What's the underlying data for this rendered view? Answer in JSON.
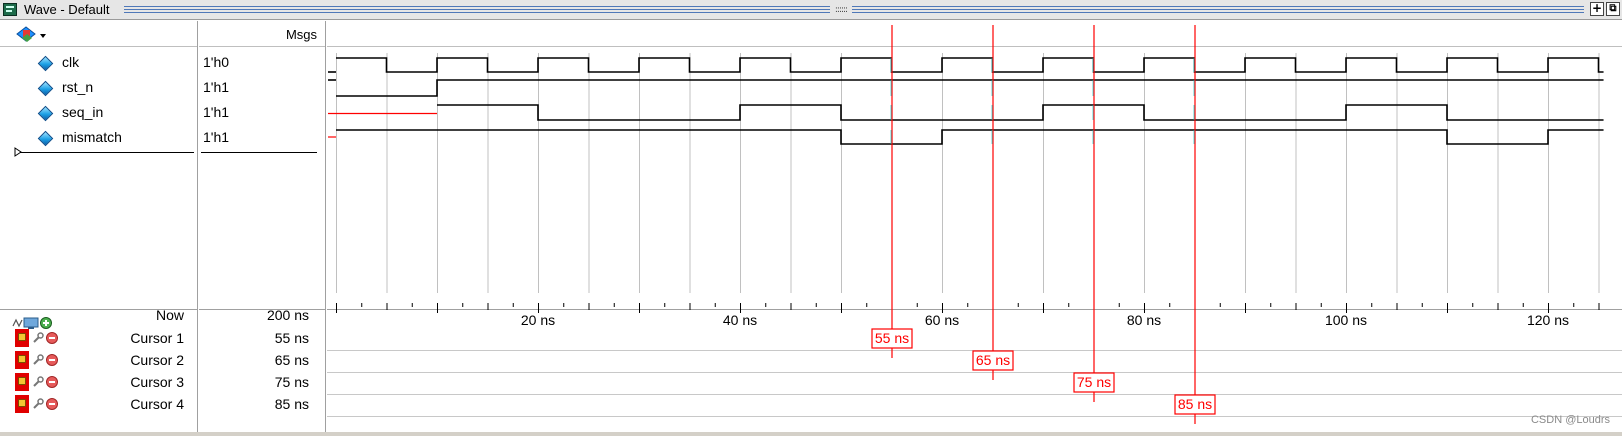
{
  "window": {
    "title": "Wave - Default",
    "grip": "::::::"
  },
  "header": {
    "msgs_label": "Msgs"
  },
  "signals": [
    {
      "name": "clk",
      "value": "1'h0"
    },
    {
      "name": "rst_n",
      "value": "1'h1"
    },
    {
      "name": "seq_in",
      "value": "1'h1"
    },
    {
      "name": "mismatch",
      "value": "1'h1"
    }
  ],
  "timeline": {
    "now_label": "Now",
    "now_value": "200 ns",
    "time_labels": [
      "20 ns",
      "40 ns",
      "60 ns",
      "80 ns",
      "100 ns",
      "120 ns"
    ]
  },
  "cursors": [
    {
      "label": "Cursor 1",
      "value": "55 ns",
      "time": 55,
      "marker": "55 ns"
    },
    {
      "label": "Cursor 2",
      "value": "65 ns",
      "time": 65,
      "marker": "65 ns"
    },
    {
      "label": "Cursor 3",
      "value": "75 ns",
      "time": 75,
      "marker": "75 ns"
    },
    {
      "label": "Cursor 4",
      "value": "85 ns",
      "time": 85,
      "marker": "85 ns"
    }
  ],
  "waves": {
    "clk_period_ns": 10,
    "clk_first_rise_ns": 0,
    "rst_n_edges": [
      {
        "t": 0,
        "v": 0
      },
      {
        "t": 10,
        "v": 1
      }
    ],
    "seq_in_edges": [
      {
        "t": 10,
        "v": 1
      },
      {
        "t": 20,
        "v": 0
      },
      {
        "t": 40,
        "v": 1
      },
      {
        "t": 50,
        "v": 0
      },
      {
        "t": 70,
        "v": 1
      },
      {
        "t": 80,
        "v": 0
      },
      {
        "t": 100,
        "v": 1
      },
      {
        "t": 110,
        "v": 0
      }
    ],
    "mismatch_edges": [
      {
        "t": 0,
        "v": 1
      },
      {
        "t": 50,
        "v": 0
      },
      {
        "t": 60,
        "v": 1
      },
      {
        "t": 110,
        "v": 0
      },
      {
        "t": 120,
        "v": 1
      }
    ]
  },
  "watermark": "CSDN @Loudrs",
  "colors": {
    "cursor": "#ff0000",
    "wave": "#000000",
    "grid": "#c0c0c0",
    "transition": "#00c8c8"
  },
  "icons": {
    "toolbar": [
      "wave-add-icon",
      "monitor-icon",
      "plus-circle-icon"
    ],
    "cursor_row": [
      "lock-icon",
      "wrench-icon",
      "delete-icon"
    ]
  }
}
